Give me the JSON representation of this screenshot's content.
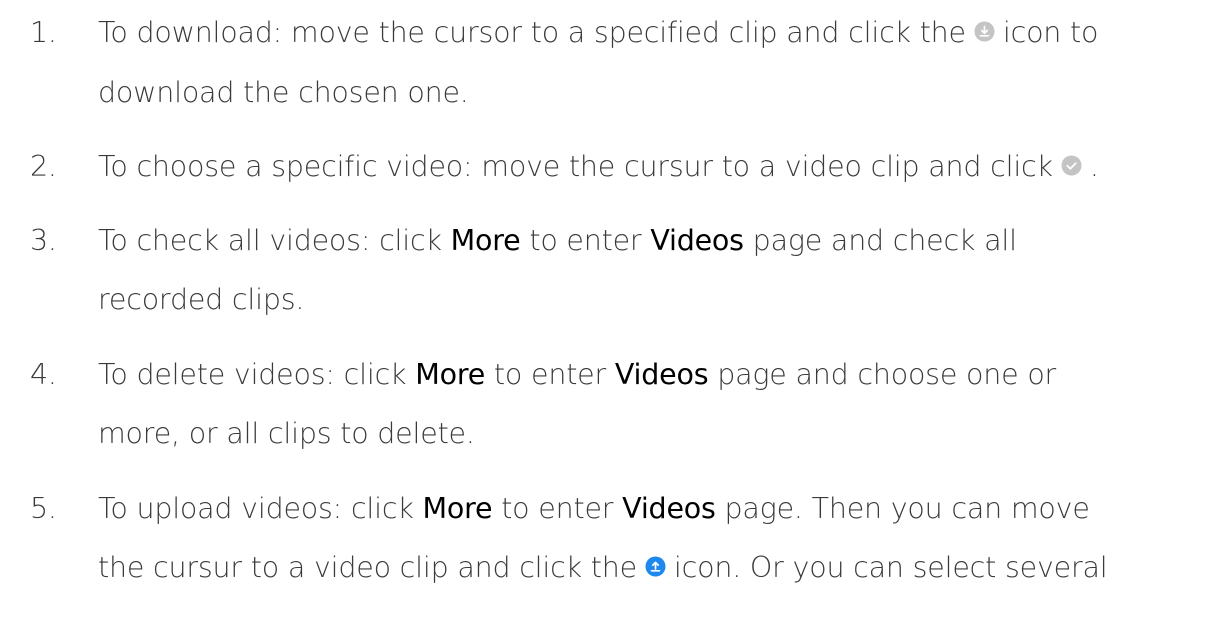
{
  "items": [
    {
      "number": "1.",
      "line1_text": "To download: move the cursor to a specified clip and click the",
      "icon": "download-circle-icon",
      "line1_after_icon": "icon to",
      "line2_text": "download the chosen one."
    },
    {
      "number": "2.",
      "line1_text": "To choose a specific video: move the cursur to a video clip and click",
      "icon": "check-circle-icon",
      "line1_after_icon": "."
    },
    {
      "number": "3.",
      "line1_prefix": "To check all videos: click",
      "more": "More",
      "middle": "to enter",
      "videos": "Videos",
      "line1_suffix": "page and check all",
      "line2_text": "recorded clips."
    },
    {
      "number": "4.",
      "line1_prefix": "To delete videos: click",
      "more": "More",
      "middle": "to enter",
      "videos": "Videos",
      "line1_suffix": "page and choose one or",
      "line2_text": "more, or all clips to delete."
    },
    {
      "number": "5.",
      "line1_prefix": "To upload videos: click",
      "more": "More",
      "middle": "to enter",
      "videos": "Videos",
      "line1_suffix": "page. Then you can move",
      "line2_prefix": "the cursur to a video clip and click the",
      "icon": "upload-circle-icon",
      "line2_suffix": "icon. Or you can select several"
    }
  ],
  "colors": {
    "text": "#3a3a3a",
    "emphasis": "#000000",
    "icon_gray": "#b7b7b7",
    "icon_blue": "#1e88ef"
  }
}
